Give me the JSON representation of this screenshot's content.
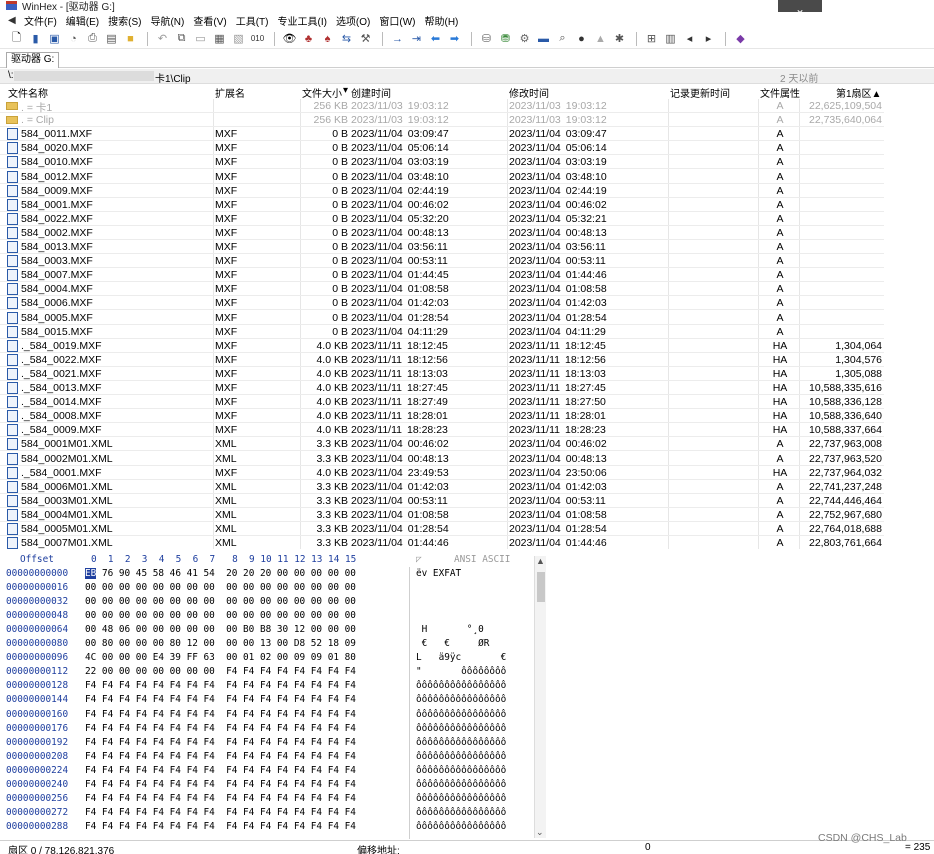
{
  "window": {
    "title": "WinHex - [驱动器 G:]"
  },
  "menu": [
    "文件(F)",
    "编辑(E)",
    "搜索(S)",
    "导航(N)",
    "查看(V)",
    "工具(T)",
    "专业工具(I)",
    "选项(O)",
    "窗口(W)",
    "帮助(H)"
  ],
  "toolbar_icons": [
    "new-file-icon",
    "open-file-icon",
    "save-icon",
    "disk-icon",
    "print-icon",
    "properties-icon",
    "open-folder-icon",
    "undo-icon",
    "copy-icon",
    "cut-icon",
    "paste-icon",
    "paste-special-icon",
    "write-icon",
    "find-icon",
    "find-hex-icon",
    "find-text-icon",
    "replace-icon",
    "replace-hex-icon",
    "goto-icon",
    "goto-offset-icon",
    "back-icon",
    "forward-icon",
    "disk-edit-icon",
    "ram-icon",
    "tools-icon",
    "calculator-icon",
    "search-folder-icon",
    "record-icon",
    "bookmark-icon",
    "settings-icon",
    "grid-icon",
    "table-icon",
    "pointer-icon",
    "cursor-icon",
    "diamond-icon"
  ],
  "tab": {
    "label": "驱动器 G:"
  },
  "path": {
    "prefix": "\\:",
    "suffix": "卡1\\Clip",
    "age": "2 天以前"
  },
  "columns": {
    "name": "文件名称",
    "ext": "扩展名",
    "size": "文件大小",
    "ctime": "创建时间",
    "mtime": "修改时间",
    "record": "记录更新时间",
    "attr": "文件属性",
    "sector": "第1扇区▲"
  },
  "files": [
    {
      "type": "folder",
      "name": ". = 卡1",
      "ext": "",
      "size": "256 KB",
      "cdate": "2023/11/03",
      "ctime": "19:03:12",
      "mdate": "2023/11/03",
      "mtime": "19:03:12",
      "attr": "A",
      "sector": "22,625,109,504",
      "dim": true
    },
    {
      "type": "folder",
      "name": ". = Clip",
      "ext": "",
      "size": "256 KB",
      "cdate": "2023/11/03",
      "ctime": "19:03:12",
      "mdate": "2023/11/03",
      "mtime": "19:03:12",
      "attr": "A",
      "sector": "22,735,640,064",
      "dim": true
    },
    {
      "type": "file",
      "name": "584_0011.MXF",
      "ext": "MXF",
      "size": "0 B",
      "cdate": "2023/11/04",
      "ctime": "03:09:47",
      "mdate": "2023/11/04",
      "mtime": "03:09:47",
      "attr": "A",
      "sector": ""
    },
    {
      "type": "file",
      "name": "584_0020.MXF",
      "ext": "MXF",
      "size": "0 B",
      "cdate": "2023/11/04",
      "ctime": "05:06:14",
      "mdate": "2023/11/04",
      "mtime": "05:06:14",
      "attr": "A",
      "sector": ""
    },
    {
      "type": "file",
      "name": "584_0010.MXF",
      "ext": "MXF",
      "size": "0 B",
      "cdate": "2023/11/04",
      "ctime": "03:03:19",
      "mdate": "2023/11/04",
      "mtime": "03:03:19",
      "attr": "A",
      "sector": ""
    },
    {
      "type": "file",
      "name": "584_0012.MXF",
      "ext": "MXF",
      "size": "0 B",
      "cdate": "2023/11/04",
      "ctime": "03:48:10",
      "mdate": "2023/11/04",
      "mtime": "03:48:10",
      "attr": "A",
      "sector": ""
    },
    {
      "type": "file",
      "name": "584_0009.MXF",
      "ext": "MXF",
      "size": "0 B",
      "cdate": "2023/11/04",
      "ctime": "02:44:19",
      "mdate": "2023/11/04",
      "mtime": "02:44:19",
      "attr": "A",
      "sector": ""
    },
    {
      "type": "file",
      "name": "584_0001.MXF",
      "ext": "MXF",
      "size": "0 B",
      "cdate": "2023/11/04",
      "ctime": "00:46:02",
      "mdate": "2023/11/04",
      "mtime": "00:46:02",
      "attr": "A",
      "sector": ""
    },
    {
      "type": "file",
      "name": "584_0022.MXF",
      "ext": "MXF",
      "size": "0 B",
      "cdate": "2023/11/04",
      "ctime": "05:32:20",
      "mdate": "2023/11/04",
      "mtime": "05:32:21",
      "attr": "A",
      "sector": ""
    },
    {
      "type": "file",
      "name": "584_0002.MXF",
      "ext": "MXF",
      "size": "0 B",
      "cdate": "2023/11/04",
      "ctime": "00:48:13",
      "mdate": "2023/11/04",
      "mtime": "00:48:13",
      "attr": "A",
      "sector": ""
    },
    {
      "type": "file",
      "name": "584_0013.MXF",
      "ext": "MXF",
      "size": "0 B",
      "cdate": "2023/11/04",
      "ctime": "03:56:11",
      "mdate": "2023/11/04",
      "mtime": "03:56:11",
      "attr": "A",
      "sector": ""
    },
    {
      "type": "file",
      "name": "584_0003.MXF",
      "ext": "MXF",
      "size": "0 B",
      "cdate": "2023/11/04",
      "ctime": "00:53:11",
      "mdate": "2023/11/04",
      "mtime": "00:53:11",
      "attr": "A",
      "sector": ""
    },
    {
      "type": "file",
      "name": "584_0007.MXF",
      "ext": "MXF",
      "size": "0 B",
      "cdate": "2023/11/04",
      "ctime": "01:44:45",
      "mdate": "2023/11/04",
      "mtime": "01:44:46",
      "attr": "A",
      "sector": ""
    },
    {
      "type": "file",
      "name": "584_0004.MXF",
      "ext": "MXF",
      "size": "0 B",
      "cdate": "2023/11/04",
      "ctime": "01:08:58",
      "mdate": "2023/11/04",
      "mtime": "01:08:58",
      "attr": "A",
      "sector": ""
    },
    {
      "type": "file",
      "name": "584_0006.MXF",
      "ext": "MXF",
      "size": "0 B",
      "cdate": "2023/11/04",
      "ctime": "01:42:03",
      "mdate": "2023/11/04",
      "mtime": "01:42:03",
      "attr": "A",
      "sector": ""
    },
    {
      "type": "file",
      "name": "584_0005.MXF",
      "ext": "MXF",
      "size": "0 B",
      "cdate": "2023/11/04",
      "ctime": "01:28:54",
      "mdate": "2023/11/04",
      "mtime": "01:28:54",
      "attr": "A",
      "sector": ""
    },
    {
      "type": "file",
      "name": "584_0015.MXF",
      "ext": "MXF",
      "size": "0 B",
      "cdate": "2023/11/04",
      "ctime": "04:11:29",
      "mdate": "2023/11/04",
      "mtime": "04:11:29",
      "attr": "A",
      "sector": ""
    },
    {
      "type": "file",
      "name": "._584_0019.MXF",
      "ext": "MXF",
      "size": "4.0 KB",
      "cdate": "2023/11/11",
      "ctime": "18:12:45",
      "mdate": "2023/11/11",
      "mtime": "18:12:45",
      "attr": "HA",
      "sector": "1,304,064"
    },
    {
      "type": "file",
      "name": "._584_0022.MXF",
      "ext": "MXF",
      "size": "4.0 KB",
      "cdate": "2023/11/11",
      "ctime": "18:12:56",
      "mdate": "2023/11/11",
      "mtime": "18:12:56",
      "attr": "HA",
      "sector": "1,304,576"
    },
    {
      "type": "file",
      "name": "._584_0021.MXF",
      "ext": "MXF",
      "size": "4.0 KB",
      "cdate": "2023/11/11",
      "ctime": "18:13:03",
      "mdate": "2023/11/11",
      "mtime": "18:13:03",
      "attr": "HA",
      "sector": "1,305,088"
    },
    {
      "type": "file",
      "name": "._584_0013.MXF",
      "ext": "MXF",
      "size": "4.0 KB",
      "cdate": "2023/11/11",
      "ctime": "18:27:45",
      "mdate": "2023/11/11",
      "mtime": "18:27:45",
      "attr": "HA",
      "sector": "10,588,335,616"
    },
    {
      "type": "file",
      "name": "._584_0014.MXF",
      "ext": "MXF",
      "size": "4.0 KB",
      "cdate": "2023/11/11",
      "ctime": "18:27:49",
      "mdate": "2023/11/11",
      "mtime": "18:27:50",
      "attr": "HA",
      "sector": "10,588,336,128"
    },
    {
      "type": "file",
      "name": "._584_0008.MXF",
      "ext": "MXF",
      "size": "4.0 KB",
      "cdate": "2023/11/11",
      "ctime": "18:28:01",
      "mdate": "2023/11/11",
      "mtime": "18:28:01",
      "attr": "HA",
      "sector": "10,588,336,640"
    },
    {
      "type": "file",
      "name": "._584_0009.MXF",
      "ext": "MXF",
      "size": "4.0 KB",
      "cdate": "2023/11/11",
      "ctime": "18:28:23",
      "mdate": "2023/11/11",
      "mtime": "18:28:23",
      "attr": "HA",
      "sector": "10,588,337,664"
    },
    {
      "type": "file",
      "name": "584_0001M01.XML",
      "ext": "XML",
      "size": "3.3 KB",
      "cdate": "2023/11/04",
      "ctime": "00:46:02",
      "mdate": "2023/11/04",
      "mtime": "00:46:02",
      "attr": "A",
      "sector": "22,737,963,008"
    },
    {
      "type": "file",
      "name": "584_0002M01.XML",
      "ext": "XML",
      "size": "3.3 KB",
      "cdate": "2023/11/04",
      "ctime": "00:48:13",
      "mdate": "2023/11/04",
      "mtime": "00:48:13",
      "attr": "A",
      "sector": "22,737,963,520"
    },
    {
      "type": "file",
      "name": "._584_0001.MXF",
      "ext": "MXF",
      "size": "4.0 KB",
      "cdate": "2023/11/04",
      "ctime": "23:49:53",
      "mdate": "2023/11/04",
      "mtime": "23:50:06",
      "attr": "HA",
      "sector": "22,737,964,032"
    },
    {
      "type": "file",
      "name": "584_0006M01.XML",
      "ext": "XML",
      "size": "3.3 KB",
      "cdate": "2023/11/04",
      "ctime": "01:42:03",
      "mdate": "2023/11/04",
      "mtime": "01:42:03",
      "attr": "A",
      "sector": "22,741,237,248"
    },
    {
      "type": "file",
      "name": "584_0003M01.XML",
      "ext": "XML",
      "size": "3.3 KB",
      "cdate": "2023/11/04",
      "ctime": "00:53:11",
      "mdate": "2023/11/04",
      "mtime": "00:53:11",
      "attr": "A",
      "sector": "22,744,446,464"
    },
    {
      "type": "file",
      "name": "584_0004M01.XML",
      "ext": "XML",
      "size": "3.3 KB",
      "cdate": "2023/11/04",
      "ctime": "01:08:58",
      "mdate": "2023/11/04",
      "mtime": "01:08:58",
      "attr": "A",
      "sector": "22,752,967,680"
    },
    {
      "type": "file",
      "name": "584_0005M01.XML",
      "ext": "XML",
      "size": "3.3 KB",
      "cdate": "2023/11/04",
      "ctime": "01:28:54",
      "mdate": "2023/11/04",
      "mtime": "01:28:54",
      "attr": "A",
      "sector": "22,764,018,688"
    },
    {
      "type": "file",
      "name": "584_0007M01.XML",
      "ext": "XML",
      "size": "3.3 KB",
      "cdate": "2023/11/04",
      "ctime": "01:44:46",
      "mdate": "2023/11/04",
      "mtime": "01:44:46",
      "attr": "A",
      "sector": "22,803,761,664"
    }
  ],
  "hex": {
    "header_offset": "Offset",
    "header_cols": "0  1  2  3  4  5  6  7   8  9 10 11 12 13 14 15",
    "header_charset": "ANSI ASCII",
    "lines": [
      {
        "off": "00000000000",
        "hex": "EB 76 90 45 58 46 41 54  20 20 20 00 00 00 00 00",
        "asc": "ëv EXFAT"
      },
      {
        "off": "00000000016",
        "hex": "00 00 00 00 00 00 00 00  00 00 00 00 00 00 00 00",
        "asc": ""
      },
      {
        "off": "00000000032",
        "hex": "00 00 00 00 00 00 00 00  00 00 00 00 00 00 00 00",
        "asc": ""
      },
      {
        "off": "00000000048",
        "hex": "00 00 00 00 00 00 00 00  00 00 00 00 00 00 00 00",
        "asc": ""
      },
      {
        "off": "00000000064",
        "hex": "00 48 06 00 00 00 00 00  00 B0 B8 30 12 00 00 00",
        "asc": " H       °¸0"
      },
      {
        "off": "00000000080",
        "hex": "00 80 00 00 00 80 12 00  00 00 13 00 D8 52 18 09",
        "asc": " €   €     ØR"
      },
      {
        "off": "00000000096",
        "hex": "4C 00 00 00 E4 39 FF 63  00 01 02 00 09 09 01 80",
        "asc": "L   ä9ÿc       €"
      },
      {
        "off": "00000000112",
        "hex": "22 00 00 00 00 00 00 00  F4 F4 F4 F4 F4 F4 F4 F4",
        "asc": "\"       ôôôôôôôô"
      },
      {
        "off": "00000000128",
        "hex": "F4 F4 F4 F4 F4 F4 F4 F4  F4 F4 F4 F4 F4 F4 F4 F4",
        "asc": "ôôôôôôôôôôôôôôôô"
      },
      {
        "off": "00000000144",
        "hex": "F4 F4 F4 F4 F4 F4 F4 F4  F4 F4 F4 F4 F4 F4 F4 F4",
        "asc": "ôôôôôôôôôôôôôôôô"
      },
      {
        "off": "00000000160",
        "hex": "F4 F4 F4 F4 F4 F4 F4 F4  F4 F4 F4 F4 F4 F4 F4 F4",
        "asc": "ôôôôôôôôôôôôôôôô"
      },
      {
        "off": "00000000176",
        "hex": "F4 F4 F4 F4 F4 F4 F4 F4  F4 F4 F4 F4 F4 F4 F4 F4",
        "asc": "ôôôôôôôôôôôôôôôô"
      },
      {
        "off": "00000000192",
        "hex": "F4 F4 F4 F4 F4 F4 F4 F4  F4 F4 F4 F4 F4 F4 F4 F4",
        "asc": "ôôôôôôôôôôôôôôôô"
      },
      {
        "off": "00000000208",
        "hex": "F4 F4 F4 F4 F4 F4 F4 F4  F4 F4 F4 F4 F4 F4 F4 F4",
        "asc": "ôôôôôôôôôôôôôôôô"
      },
      {
        "off": "00000000224",
        "hex": "F4 F4 F4 F4 F4 F4 F4 F4  F4 F4 F4 F4 F4 F4 F4 F4",
        "asc": "ôôôôôôôôôôôôôôôô"
      },
      {
        "off": "00000000240",
        "hex": "F4 F4 F4 F4 F4 F4 F4 F4  F4 F4 F4 F4 F4 F4 F4 F4",
        "asc": "ôôôôôôôôôôôôôôôô"
      },
      {
        "off": "00000000256",
        "hex": "F4 F4 F4 F4 F4 F4 F4 F4  F4 F4 F4 F4 F4 F4 F4 F4",
        "asc": "ôôôôôôôôôôôôôôôô"
      },
      {
        "off": "00000000272",
        "hex": "F4 F4 F4 F4 F4 F4 F4 F4  F4 F4 F4 F4 F4 F4 F4 F4",
        "asc": "ôôôôôôôôôôôôôôôô"
      },
      {
        "off": "00000000288",
        "hex": "F4 F4 F4 F4 F4 F4 F4 F4  F4 F4 F4 F4 F4 F4 F4 F4",
        "asc": "ôôôôôôôôôôôôôôôô"
      }
    ]
  },
  "status": {
    "sector": "扇区 0 / 78,126,821,376",
    "offset_label": "偏移地址:",
    "offset_value": "0",
    "value": "= 235"
  },
  "watermark": "CSDN @CHS_Lab"
}
